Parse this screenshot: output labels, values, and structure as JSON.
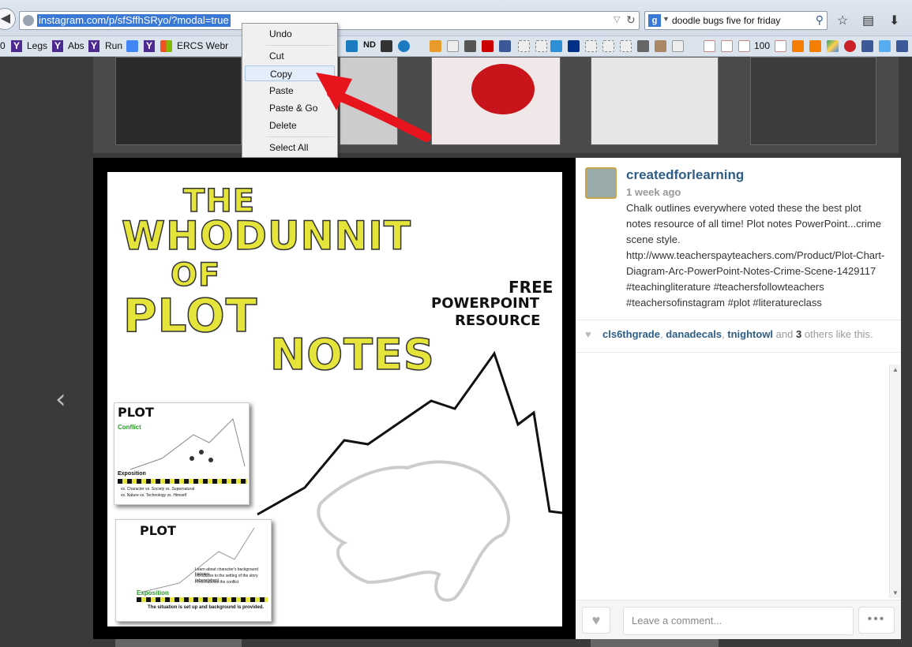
{
  "browser": {
    "url": "instagram.com/p/sfSffhSRyo/?modal=true",
    "search_engine": "g",
    "search_query": "doodle bugs five for friday",
    "bookmarks": [
      {
        "label": "0",
        "icon": "globe-icon"
      },
      {
        "label": "Legs",
        "icon": "yahoo-icon"
      },
      {
        "label": "Abs",
        "icon": "yahoo-icon"
      },
      {
        "label": "Run",
        "icon": "yahoo-icon"
      },
      {
        "label": "ERCS Webr",
        "icon": "windows-icon"
      },
      {
        "label": "ND",
        "icon": "nd-icon"
      },
      {
        "label": "100",
        "icon": "pinterest-icon"
      }
    ]
  },
  "context_menu": {
    "items": [
      "Undo",
      "Cut",
      "Copy",
      "Paste",
      "Paste & Go",
      "Delete",
      "Select All"
    ],
    "highlighted": "Copy"
  },
  "post_image": {
    "title_lines": [
      "THE",
      "WHODUNNIT",
      "OF",
      "PLOT",
      "NOTES"
    ],
    "free_lines": [
      "FREE",
      "POWERPOINT",
      "RESOURCE"
    ],
    "card1": {
      "title": "PLOT",
      "conflict": "Conflict",
      "exposition": "Exposition",
      "caution": "CAUTION CAUTION CAUTION CAUTION",
      "rows": [
        "vs. Character  vs. Society  vs. Supernatural",
        "vs. Nature  vs. Technology  vs. Himself"
      ]
    },
    "card2": {
      "title": "PLOT",
      "exposition": "Exposition",
      "caution": "CAUTION CAUTION CAUTION CAUTION",
      "bullets": [
        "Learn about character's background histories",
        "Introduces to the setting of the story (where/when)",
        "Foreshadows the conflict"
      ],
      "footer": "The situation is set up and background is provided."
    }
  },
  "post": {
    "username": "createdforlearning",
    "time": "1 week ago",
    "caption": "Chalk outlines everywhere voted these the best plot notes resource of all time! Plot notes PowerPoint...crime scene style. http://www.teacherspayteachers.com/Product/Plot-Chart-Diagram-Arc-PowerPoint-Notes-Crime-Scene-1429117 #teachingliterature #teachersfollowteachers #teachersofinstagram #plot #literatureclass",
    "likers": [
      "cls6thgrade",
      "danadecals",
      "tnightowl"
    ],
    "likes_and": "and",
    "likes_others_count": "3",
    "likes_suffix": "others like this.",
    "comment_placeholder": "Leave a comment...",
    "more_label": "•••"
  },
  "colors": {
    "accent": "#2e5e86",
    "title_yellow": "#e4e43a",
    "arrow_red": "#e8141d",
    "url_highlight": "#3a78d6"
  }
}
